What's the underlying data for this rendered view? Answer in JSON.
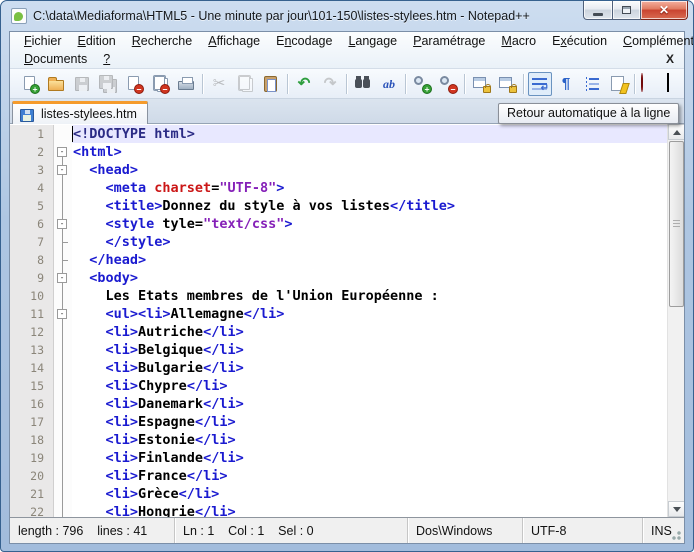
{
  "window": {
    "title": "C:\\data\\Mediaforma\\HTML5 - Une minute par jour\\101-150\\listes-stylees.htm - Notepad++",
    "controls": {
      "minimize": "minimize",
      "restore": "restore",
      "close": "close"
    }
  },
  "menu": {
    "row1": [
      {
        "label": "Fichier",
        "u": 0
      },
      {
        "label": "Edition",
        "u": 0
      },
      {
        "label": "Recherche",
        "u": 0
      },
      {
        "label": "Affichage",
        "u": 0
      },
      {
        "label": "Encodage",
        "u": 1
      },
      {
        "label": "Langage",
        "u": 0
      },
      {
        "label": "Paramétrage",
        "u": 0
      },
      {
        "label": "Macro",
        "u": 0
      },
      {
        "label": "Exécution",
        "u": 1
      },
      {
        "label": "Compléments",
        "u": 0
      }
    ],
    "row2": [
      {
        "label": "Documents",
        "u": 0
      },
      {
        "label": "?",
        "u": 0
      }
    ],
    "close_label": "X"
  },
  "toolbar": {
    "buttons": [
      {
        "name": "new-file",
        "icon": "page-plus"
      },
      {
        "name": "open-file",
        "icon": "folder"
      },
      {
        "name": "save-file",
        "icon": "floppy",
        "disabled": true
      },
      {
        "name": "save-all",
        "icon": "floppy-all",
        "disabled": true
      },
      {
        "name": "close-file",
        "icon": "page-minus"
      },
      {
        "name": "close-all-files",
        "icon": "pages-minus"
      },
      {
        "name": "print",
        "icon": "printer"
      },
      {
        "sep": true
      },
      {
        "name": "cut",
        "icon": "scissors",
        "disabled": true
      },
      {
        "name": "copy",
        "icon": "copy",
        "disabled": true
      },
      {
        "name": "paste",
        "icon": "clipboard"
      },
      {
        "sep": true
      },
      {
        "name": "undo",
        "icon": "undo"
      },
      {
        "name": "redo",
        "icon": "redo",
        "disabled": true
      },
      {
        "sep": true
      },
      {
        "name": "find",
        "icon": "binoculars"
      },
      {
        "name": "replace",
        "icon": "replace"
      },
      {
        "sep": true
      },
      {
        "name": "zoom-in",
        "icon": "zoom-in"
      },
      {
        "name": "zoom-out",
        "icon": "zoom-out"
      },
      {
        "sep": true
      },
      {
        "name": "sync-vertical-scroll",
        "icon": "sync-window"
      },
      {
        "name": "sync-horizontal-scroll",
        "icon": "sync-window"
      },
      {
        "sep": true
      },
      {
        "name": "word-wrap",
        "icon": "word-wrap",
        "active": true
      },
      {
        "name": "show-all-characters",
        "icon": "pilcrow"
      },
      {
        "name": "show-indent-guide",
        "icon": "indent-guide"
      },
      {
        "name": "user-defined-language",
        "icon": "udl"
      },
      {
        "sep": true
      },
      {
        "name": "macro-record",
        "icon": "record"
      },
      {
        "name": "macro-stop",
        "icon": "stop"
      },
      {
        "name": "macro-play",
        "icon": "play"
      }
    ],
    "overflow_glyph": "»"
  },
  "tabbar": {
    "tabs": [
      {
        "label": "listes-stylees.htm",
        "active": true
      }
    ]
  },
  "tooltip": {
    "text": "Retour automatique à la ligne"
  },
  "editor": {
    "colors": {
      "tag": "#1a1ad0",
      "attr": "#cb1616",
      "val": "#8520b8",
      "txt": "#000000",
      "doc": "#2b2b85",
      "curline": "#e8e8ff"
    },
    "lines": [
      {
        "n": 1,
        "fold": "none",
        "current": true,
        "segments": [
          {
            "c": "doc",
            "t": "<!DOCTYPE html>"
          }
        ]
      },
      {
        "n": 2,
        "fold": "start",
        "segments": [
          {
            "c": "tag",
            "t": "<html>"
          }
        ]
      },
      {
        "n": 3,
        "fold": "minus",
        "segments": [
          {
            "c": "tag",
            "t": "  <head>"
          }
        ]
      },
      {
        "n": 4,
        "fold": "line",
        "segments": [
          {
            "c": "tag",
            "t": "    <meta "
          },
          {
            "c": "attr",
            "t": "charset"
          },
          {
            "c": "pln",
            "t": "="
          },
          {
            "c": "val",
            "t": "\"UTF-8\""
          },
          {
            "c": "tag",
            "t": ">"
          }
        ]
      },
      {
        "n": 5,
        "fold": "line",
        "segments": [
          {
            "c": "tag",
            "t": "    <title>"
          },
          {
            "c": "txt",
            "t": "Donnez du style à vos listes"
          },
          {
            "c": "tag",
            "t": "</title>"
          }
        ]
      },
      {
        "n": 6,
        "fold": "minus",
        "segments": [
          {
            "c": "tag",
            "t": "    <style "
          },
          {
            "c": "pln",
            "t": "tyle"
          },
          {
            "c": "pln",
            "t": "="
          },
          {
            "c": "val",
            "t": "\"text/css\""
          },
          {
            "c": "tag",
            "t": ">"
          }
        ]
      },
      {
        "n": 7,
        "fold": "tick",
        "segments": [
          {
            "c": "tag",
            "t": "    </style>"
          }
        ]
      },
      {
        "n": 8,
        "fold": "tick",
        "segments": [
          {
            "c": "tag",
            "t": "  </head>"
          }
        ]
      },
      {
        "n": 9,
        "fold": "minus",
        "segments": [
          {
            "c": "tag",
            "t": "  <body>"
          }
        ]
      },
      {
        "n": 10,
        "fold": "line",
        "segments": [
          {
            "c": "txt",
            "t": "    Les Etats membres de l'Union Européenne :"
          }
        ]
      },
      {
        "n": 11,
        "fold": "minus",
        "segments": [
          {
            "c": "tag",
            "t": "    <ul><li>"
          },
          {
            "c": "txt",
            "t": "Allemagne"
          },
          {
            "c": "tag",
            "t": "</li>"
          }
        ]
      },
      {
        "n": 12,
        "fold": "line",
        "segments": [
          {
            "c": "tag",
            "t": "    <li>"
          },
          {
            "c": "txt",
            "t": "Autriche"
          },
          {
            "c": "tag",
            "t": "</li>"
          }
        ]
      },
      {
        "n": 13,
        "fold": "line",
        "segments": [
          {
            "c": "tag",
            "t": "    <li>"
          },
          {
            "c": "txt",
            "t": "Belgique"
          },
          {
            "c": "tag",
            "t": "</li>"
          }
        ]
      },
      {
        "n": 14,
        "fold": "line",
        "segments": [
          {
            "c": "tag",
            "t": "    <li>"
          },
          {
            "c": "txt",
            "t": "Bulgarie"
          },
          {
            "c": "tag",
            "t": "</li>"
          }
        ]
      },
      {
        "n": 15,
        "fold": "line",
        "segments": [
          {
            "c": "tag",
            "t": "    <li>"
          },
          {
            "c": "txt",
            "t": "Chypre"
          },
          {
            "c": "tag",
            "t": "</li>"
          }
        ]
      },
      {
        "n": 16,
        "fold": "line",
        "segments": [
          {
            "c": "tag",
            "t": "    <li>"
          },
          {
            "c": "txt",
            "t": "Danemark"
          },
          {
            "c": "tag",
            "t": "</li>"
          }
        ]
      },
      {
        "n": 17,
        "fold": "line",
        "segments": [
          {
            "c": "tag",
            "t": "    <li>"
          },
          {
            "c": "txt",
            "t": "Espagne"
          },
          {
            "c": "tag",
            "t": "</li>"
          }
        ]
      },
      {
        "n": 18,
        "fold": "line",
        "segments": [
          {
            "c": "tag",
            "t": "    <li>"
          },
          {
            "c": "txt",
            "t": "Estonie"
          },
          {
            "c": "tag",
            "t": "</li>"
          }
        ]
      },
      {
        "n": 19,
        "fold": "line",
        "segments": [
          {
            "c": "tag",
            "t": "    <li>"
          },
          {
            "c": "txt",
            "t": "Finlande"
          },
          {
            "c": "tag",
            "t": "</li>"
          }
        ]
      },
      {
        "n": 20,
        "fold": "line",
        "segments": [
          {
            "c": "tag",
            "t": "    <li>"
          },
          {
            "c": "txt",
            "t": "France"
          },
          {
            "c": "tag",
            "t": "</li>"
          }
        ]
      },
      {
        "n": 21,
        "fold": "line",
        "segments": [
          {
            "c": "tag",
            "t": "    <li>"
          },
          {
            "c": "txt",
            "t": "Grèce"
          },
          {
            "c": "tag",
            "t": "</li>"
          }
        ]
      },
      {
        "n": 22,
        "fold": "line",
        "segments": [
          {
            "c": "tag",
            "t": "    <li>"
          },
          {
            "c": "txt",
            "t": "Hongrie"
          },
          {
            "c": "tag",
            "t": "</li>"
          }
        ]
      }
    ]
  },
  "statusbar": {
    "segments": [
      {
        "name": "doc-length-lines",
        "text": "length : 796    lines : 41"
      },
      {
        "name": "cursor-position",
        "text": "Ln : 1    Col : 1    Sel : 0"
      },
      {
        "name": "eol-format",
        "text": "Dos\\Windows"
      },
      {
        "name": "encoding",
        "text": "UTF-8"
      },
      {
        "name": "insert-mode",
        "text": "INS"
      }
    ]
  }
}
